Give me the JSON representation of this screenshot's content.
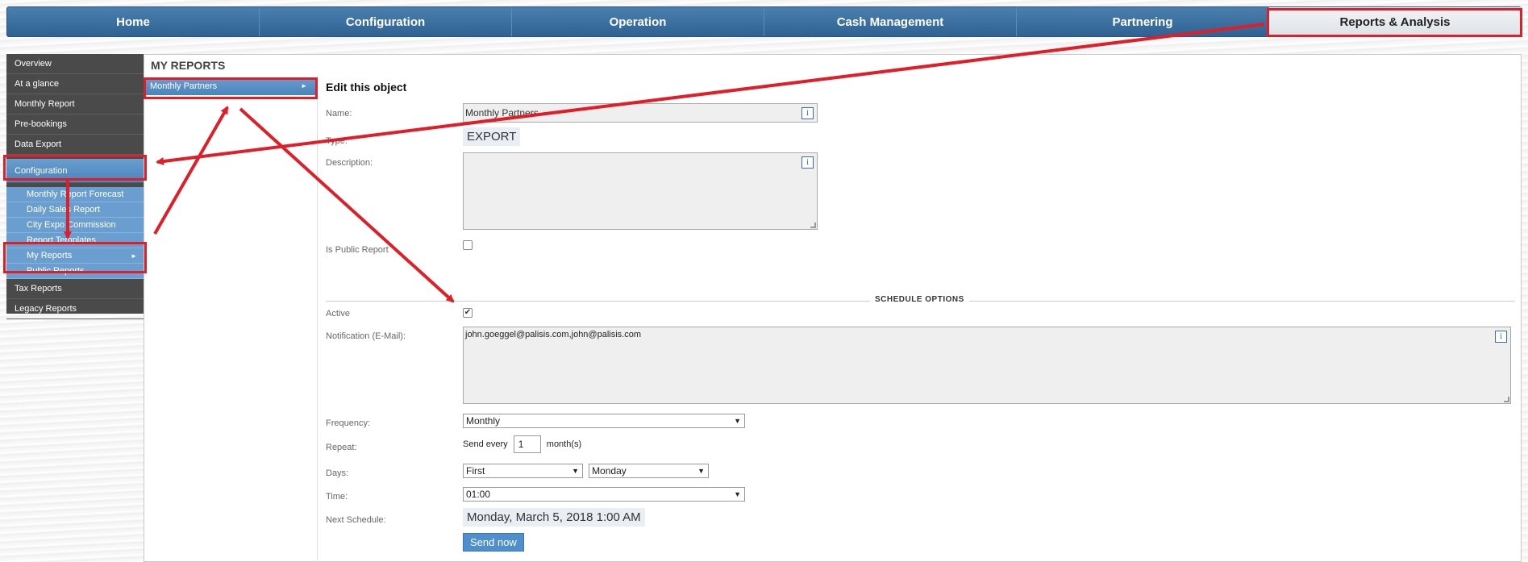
{
  "topnav": {
    "tabs": [
      "Home",
      "Configuration",
      "Operation",
      "Cash Management",
      "Partnering",
      "Reports & Analysis"
    ],
    "active": "Reports & Analysis"
  },
  "sidebar": {
    "items": [
      "Overview",
      "At a glance",
      "Monthly Report",
      "Pre-bookings",
      "Data Export"
    ],
    "active_item": "Configuration",
    "sub_items": [
      "Monthly Report Forecast",
      "Daily Sales Report",
      "City Expo Commission",
      "Report Templates",
      "My Reports",
      "Public Reports"
    ],
    "bottom_items": [
      "Tax Reports",
      "Legacy Reports"
    ]
  },
  "panel": {
    "title": "MY REPORTS",
    "list_item": "Monthly Partners"
  },
  "form": {
    "heading": "Edit this object",
    "name_label": "Name:",
    "name_value": "Monthly Partners",
    "type_label": "Type:",
    "type_value": "EXPORT",
    "description_label": "Description:",
    "description_value": "",
    "public_label": "Is Public Report",
    "public_checked": false,
    "schedule_title": "SCHEDULE OPTIONS",
    "active_label": "Active",
    "active_checked": true,
    "notification_label": "Notification (E-Mail):",
    "notification_value": "john.goeggel@palisis.com,john@palisis.com",
    "frequency_label": "Frequency:",
    "frequency_value": "Monthly",
    "repeat_label": "Repeat:",
    "repeat_prefix": "Send every",
    "repeat_value": "1",
    "repeat_suffix": "month(s)",
    "days_label": "Days:",
    "days_ordinal": "First",
    "days_weekday": "Monday",
    "time_label": "Time:",
    "time_value": "01:00",
    "next_label": "Next Schedule:",
    "next_value": "Monday, March 5, 2018 1:00 AM",
    "send_now": "Send now",
    "info_icon": "i"
  },
  "colors": {
    "nav_blue": "#2f6292",
    "highlight_red": "#e01e28",
    "sidebar_dark": "#4a4a4a",
    "selected_blue": "#4a84bc"
  }
}
